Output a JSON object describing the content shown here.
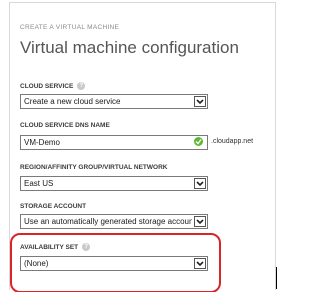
{
  "header": {
    "subtitle": "CREATE A VIRTUAL MACHINE",
    "title": "Virtual machine configuration"
  },
  "fields": {
    "cloud_service": {
      "label": "CLOUD SERVICE",
      "value": "Create a new cloud service",
      "help_icon": "help-icon"
    },
    "dns_name": {
      "label": "CLOUD SERVICE DNS NAME",
      "value": "VM-Demo",
      "suffix": ".cloudapp.net",
      "status_icon": "check-icon",
      "status_color": "#5cb82f"
    },
    "region": {
      "label": "REGION/AFFINITY GROUP/VIRTUAL NETWORK",
      "value": "East US"
    },
    "storage": {
      "label": "STORAGE ACCOUNT",
      "value": "Use an automatically generated storage account"
    },
    "availability_set": {
      "label": "AVAILABILITY SET",
      "value": "(None)",
      "help_icon": "help-icon",
      "highlight_color": "#d9252a"
    }
  }
}
